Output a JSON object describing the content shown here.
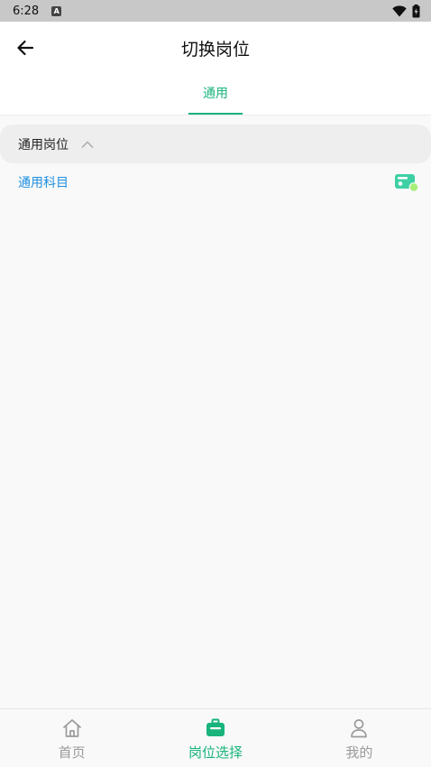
{
  "status_bar": {
    "time": "6:28",
    "notification_letter": "A"
  },
  "header": {
    "title": "切换岗位",
    "back_icon": "back-arrow-icon"
  },
  "tabs": [
    {
      "label": "通用",
      "active": true
    }
  ],
  "group": {
    "title": "通用岗位",
    "expanded": true
  },
  "subjects": [
    {
      "label": "通用科目"
    }
  ],
  "bottom_nav": {
    "items": [
      {
        "label": "首页",
        "icon": "home-icon",
        "active": false
      },
      {
        "label": "岗位选择",
        "icon": "briefcase-icon",
        "active": true
      },
      {
        "label": "我的",
        "icon": "person-icon",
        "active": false
      }
    ]
  },
  "colors": {
    "accent": "#18b47b",
    "link": "#1e8fe0",
    "inactive": "#9a9a9a",
    "status_bar": "#c8c8c8"
  }
}
